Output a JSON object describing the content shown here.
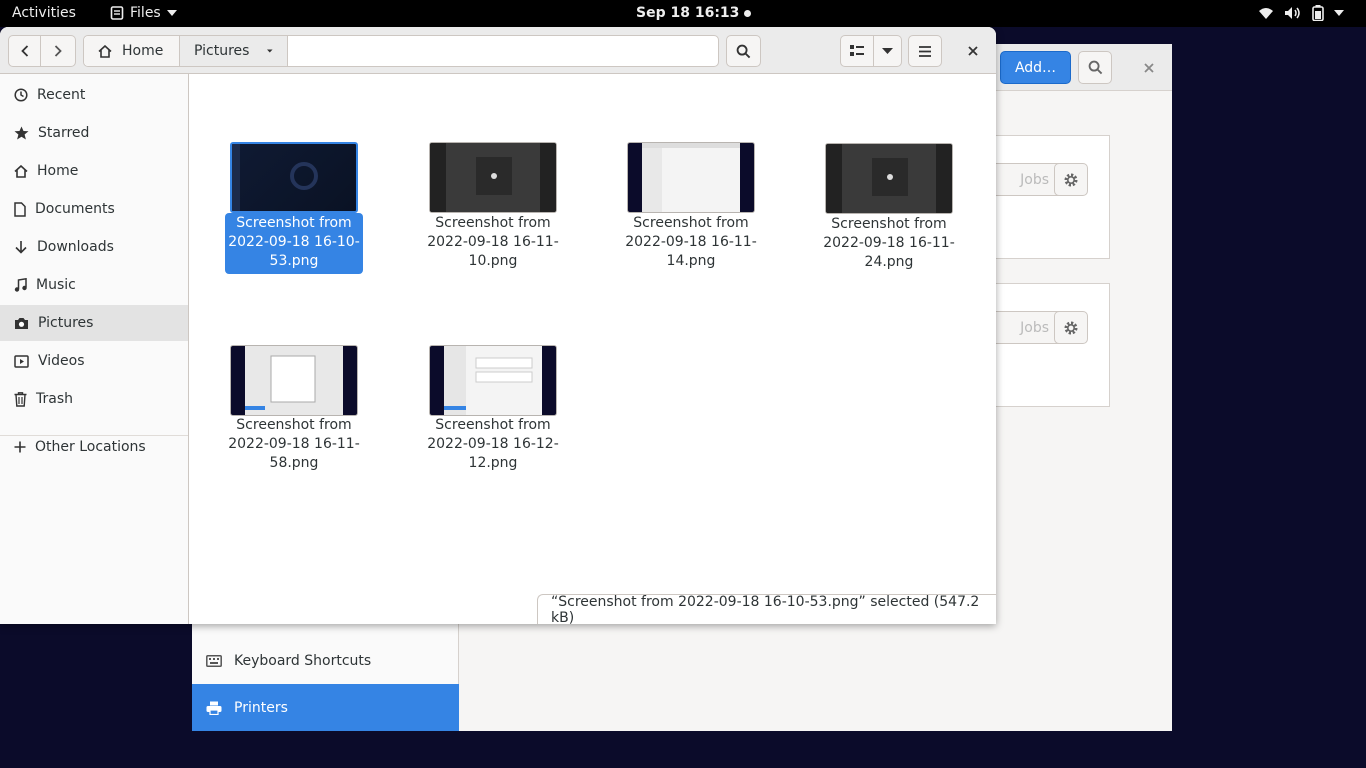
{
  "topbar": {
    "activities": "Activities",
    "app_name": "Files",
    "clock": "Sep 18  16:13"
  },
  "settings_window": {
    "add_button": "Add…",
    "jobs_label": "Jobs",
    "sidebar_items": [
      {
        "label": "Keyboard Shortcuts",
        "icon": "keyboard-icon"
      },
      {
        "label": "Printers",
        "icon": "printer-icon",
        "selected": true
      }
    ]
  },
  "files_window": {
    "breadcrumb": {
      "home": "Home",
      "current": "Pictures"
    },
    "sidebar": [
      {
        "label": "Recent",
        "icon": "clock-icon"
      },
      {
        "label": "Starred",
        "icon": "star-icon"
      },
      {
        "label": "Home",
        "icon": "home-icon"
      },
      {
        "label": "Documents",
        "icon": "document-icon"
      },
      {
        "label": "Downloads",
        "icon": "download-icon"
      },
      {
        "label": "Music",
        "icon": "music-icon"
      },
      {
        "label": "Pictures",
        "icon": "camera-icon",
        "active": true
      },
      {
        "label": "Videos",
        "icon": "video-icon"
      },
      {
        "label": "Trash",
        "icon": "trash-icon"
      },
      {
        "label": "Other Locations",
        "icon": "plus-icon"
      }
    ],
    "files": [
      {
        "name": "Screenshot from 2022-09-18 16-10-53.png",
        "selected": true
      },
      {
        "name": "Screenshot from 2022-09-18 16-11-10.png"
      },
      {
        "name": "Screenshot from 2022-09-18 16-11-14.png"
      },
      {
        "name": "Screenshot from 2022-09-18 16-11-24.png"
      },
      {
        "name": "Screenshot from 2022-09-18 16-11-58.png"
      },
      {
        "name": "Screenshot from 2022-09-18 16-12-12.png"
      }
    ],
    "status": "“Screenshot from 2022-09-18 16-10-53.png” selected  (547.2 kB)"
  },
  "colors": {
    "accent": "#3584e4",
    "panel": "#000000",
    "desktop": "#0b0b2a"
  }
}
